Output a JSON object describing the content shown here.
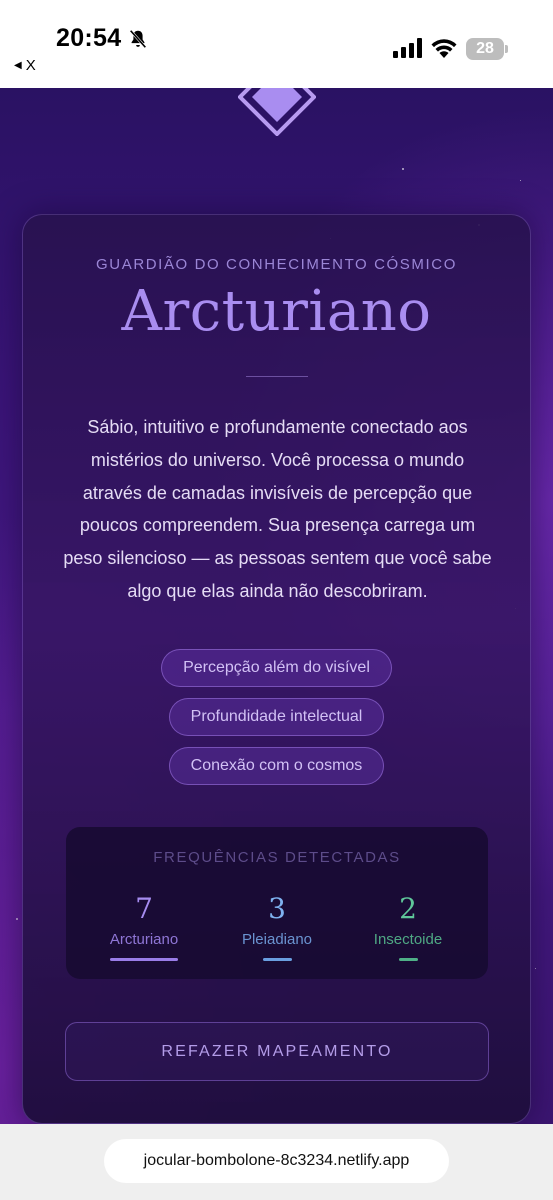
{
  "status_bar": {
    "time": "20:54",
    "back_label": "X",
    "battery": "28",
    "icons": [
      "bell-muted-icon",
      "signal-icon",
      "wifi-icon",
      "battery-icon"
    ]
  },
  "hero": {
    "eyebrow": "GUARDIÃO DO CONHECIMENTO CÓSMICO",
    "title": "Arcturiano",
    "description": "Sábio, intuitivo e profundamente conectado aos mistérios do universo. Você processa o mundo através de camadas invisíveis de percepção que poucos compreendem. Sua presença carrega um peso silencioso — as pessoas sentem que você sabe algo que elas ainda não descobriram."
  },
  "tags": [
    "Percepção além do visível",
    "Profundidade intelectual",
    "Conexão com o cosmos"
  ],
  "frequencies": {
    "title": "FREQUÊNCIAS DETECTADAS",
    "items": [
      {
        "value": "7",
        "label": "Arcturiano",
        "color": "#a68cf0",
        "bar_color": "#9a7de8"
      },
      {
        "value": "3",
        "label": "Pleiadiano",
        "color": "#7fb2f0",
        "bar_color": "#6a9fe0"
      },
      {
        "value": "2",
        "label": "Insectoide",
        "color": "#5fc79a",
        "bar_color": "#4fb087"
      }
    ]
  },
  "actions": {
    "redo_label": "REFAZER MAPEAMENTO"
  },
  "browser": {
    "url": "jocular-bombolone-8c3234.netlify.app"
  }
}
